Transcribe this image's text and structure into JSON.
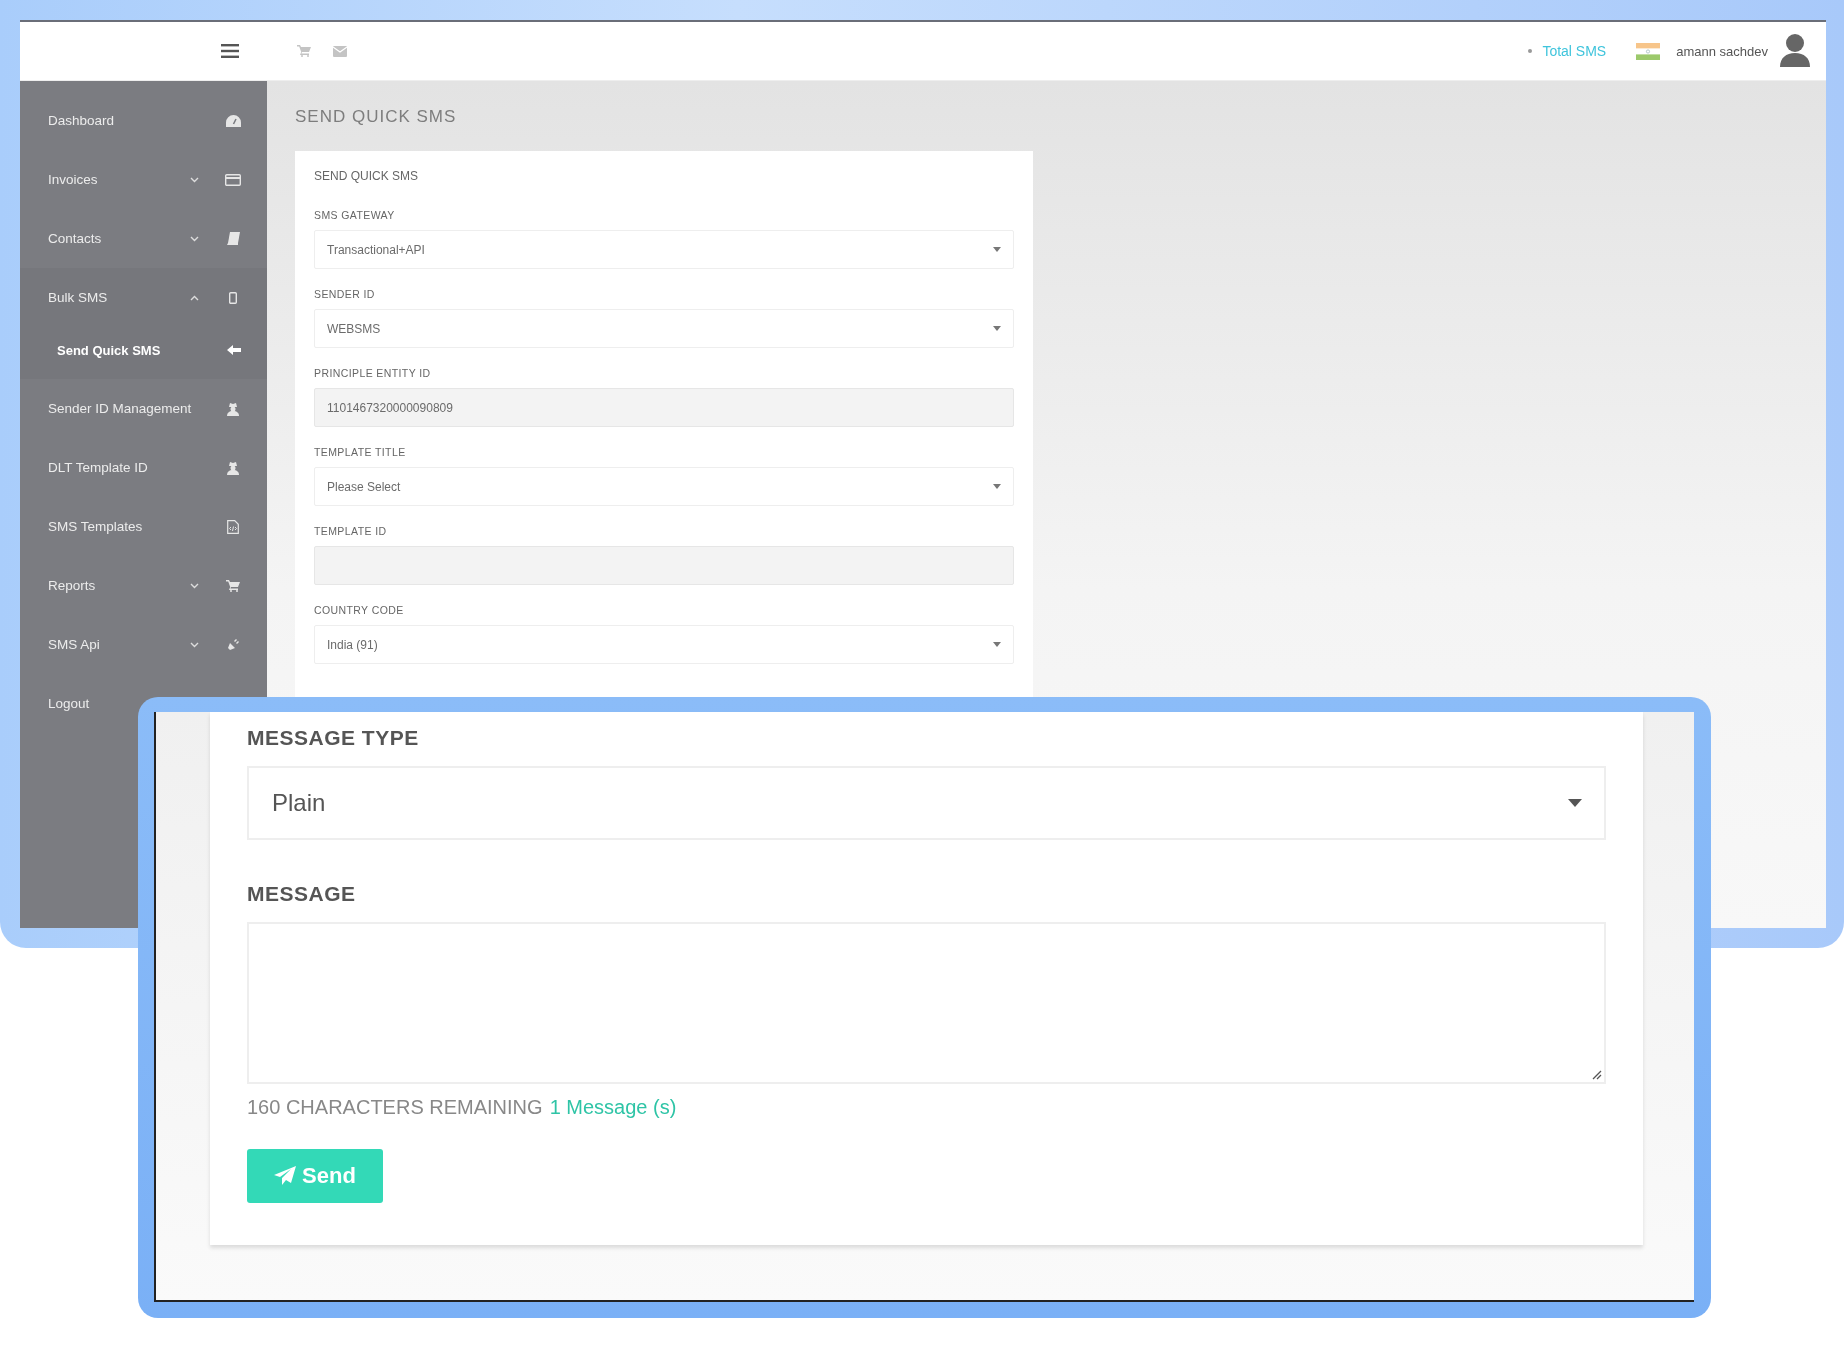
{
  "topbar": {
    "total_sms": "Total SMS",
    "user_name": "amann sachdev"
  },
  "sidebar": {
    "items": [
      {
        "label": "Dashboard"
      },
      {
        "label": "Invoices",
        "expanded": false
      },
      {
        "label": "Contacts",
        "expanded": false
      },
      {
        "label": "Bulk SMS",
        "expanded": true,
        "children": [
          {
            "label": "Send Quick SMS",
            "selected": true
          }
        ]
      },
      {
        "label": "Sender ID Management"
      },
      {
        "label": "DLT Template ID"
      },
      {
        "label": "SMS Templates"
      },
      {
        "label": "Reports",
        "expanded": false
      },
      {
        "label": "SMS Api",
        "expanded": false
      },
      {
        "label": "Logout"
      }
    ]
  },
  "page_title": "SEND QUICK SMS",
  "form": {
    "title": "SEND QUICK SMS",
    "fields": [
      {
        "label": "SMS GATEWAY",
        "kind": "select",
        "value": "Transactional+API"
      },
      {
        "label": "SENDER ID",
        "kind": "select",
        "value": "WEBSMS"
      },
      {
        "label": "PRINCIPLE ENTITY ID",
        "kind": "readonly",
        "value": "1101467320000090809"
      },
      {
        "label": "TEMPLATE TITLE",
        "kind": "select",
        "value": "Please Select"
      },
      {
        "label": "TEMPLATE ID",
        "kind": "readonly"
      },
      {
        "label": "COUNTRY CODE",
        "kind": "select",
        "value": "India (91)"
      }
    ]
  },
  "zoom_panel": {
    "message_type": {
      "label": "MESSAGE TYPE",
      "value": "Plain"
    },
    "message": {
      "label": "MESSAGE"
    },
    "counter": {
      "remaining": "160 CHARACTERS REMAINING",
      "messages": "1 Message (s)"
    },
    "send_button": "Send"
  }
}
